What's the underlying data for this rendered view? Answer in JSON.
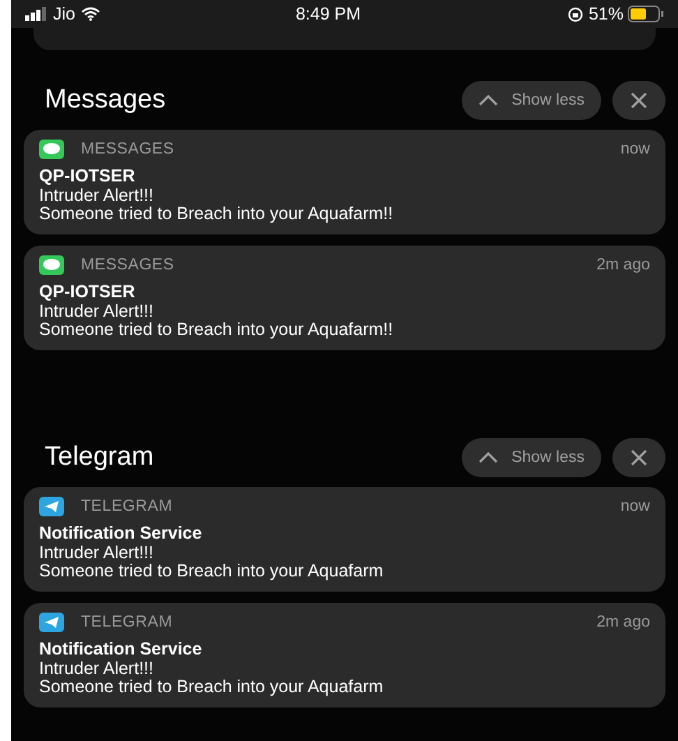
{
  "status_bar": {
    "carrier": "Jio",
    "time": "8:49 PM",
    "battery": "51%"
  },
  "groups": [
    {
      "title": "Messages",
      "show_less": "Show less",
      "kind": "messages",
      "notifications": [
        {
          "app_name": "MESSAGES",
          "time": "now",
          "sender": "QP-IOTSER",
          "lines": [
            "Intruder Alert!!!",
            "Someone tried to Breach into your Aquafarm!!"
          ]
        },
        {
          "app_name": "MESSAGES",
          "time": "2m ago",
          "sender": "QP-IOTSER",
          "lines": [
            "Intruder Alert!!!",
            "Someone tried to Breach into your Aquafarm!!"
          ]
        }
      ]
    },
    {
      "title": "Telegram",
      "show_less": "Show less",
      "kind": "telegram",
      "notifications": [
        {
          "app_name": "TELEGRAM",
          "time": "now",
          "sender": "Notification Service",
          "lines": [
            "Intruder Alert!!!",
            "Someone tried to Breach into your Aquafarm"
          ]
        },
        {
          "app_name": "TELEGRAM",
          "time": "2m ago",
          "sender": "Notification Service",
          "lines": [
            "Intruder Alert!!!",
            "Someone tried to Breach into your Aquafarm"
          ]
        }
      ]
    }
  ]
}
